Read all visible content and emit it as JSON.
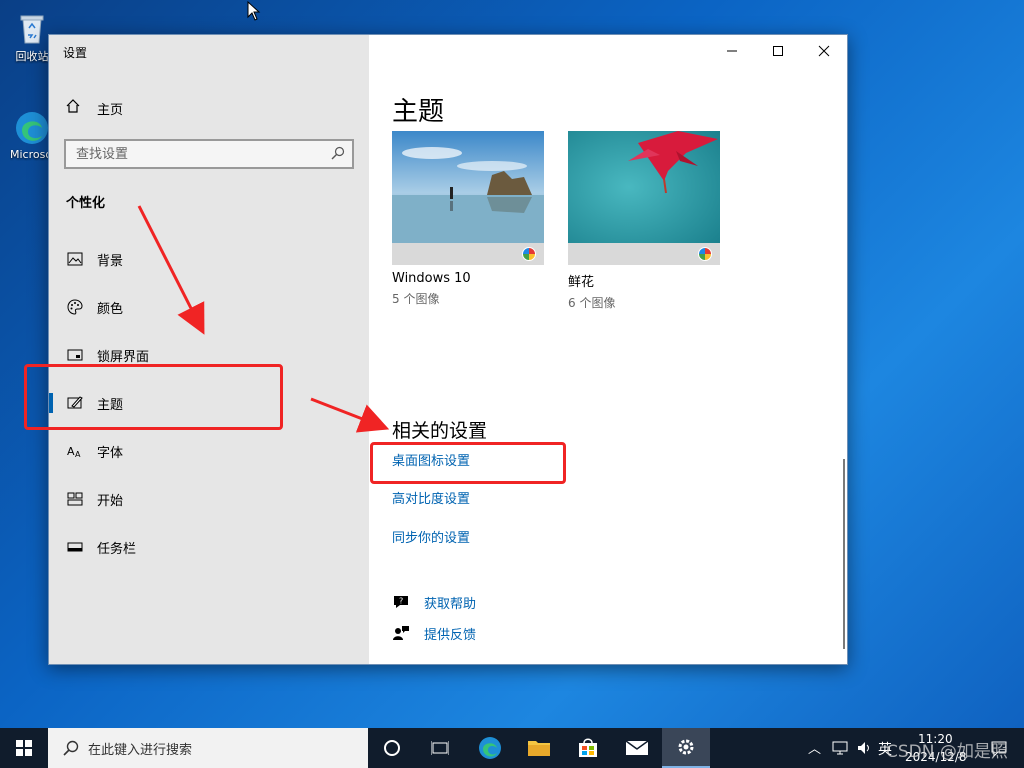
{
  "desktop": {
    "icons": [
      {
        "label": "回收站",
        "icon": "recycle-bin-icon"
      },
      {
        "label": "Microsoft Edge",
        "icon": "edge-icon"
      }
    ]
  },
  "window": {
    "title": "设置",
    "controls": [
      "minimize",
      "maximize",
      "close"
    ]
  },
  "sidebar": {
    "home_label": "主页",
    "search_placeholder": "查找设置",
    "section_title": "个性化",
    "items": [
      {
        "label": "背景",
        "icon": "picture-icon"
      },
      {
        "label": "颜色",
        "icon": "palette-icon"
      },
      {
        "label": "锁屏界面",
        "icon": "lock-screen-icon"
      },
      {
        "label": "主题",
        "icon": "theme-brush-icon",
        "active": true
      },
      {
        "label": "字体",
        "icon": "font-icon"
      },
      {
        "label": "开始",
        "icon": "start-tiles-icon"
      },
      {
        "label": "任务栏",
        "icon": "taskbar-icon"
      }
    ]
  },
  "main": {
    "title": "主题",
    "themes": [
      {
        "name": "Windows 10",
        "count": "5 个图像"
      },
      {
        "name": "鲜花",
        "count": "6 个图像"
      }
    ],
    "related_title": "相关的设置",
    "related_links": [
      "桌面图标设置",
      "高对比度设置",
      "同步你的设置"
    ],
    "help": {
      "get_help": "获取帮助",
      "feedback": "提供反馈"
    }
  },
  "taskbar": {
    "search_placeholder": "在此键入进行搜索",
    "apps": [
      "task-view-icon",
      "edge-icon",
      "file-explorer-icon",
      "store-icon",
      "mail-icon",
      "settings-gear-icon"
    ],
    "ime": "英",
    "time": "11:20",
    "date": "2024/12/8"
  },
  "watermark": "CSDN @如是照",
  "colors": {
    "accent": "#0063b1",
    "annotation": "#f02424",
    "taskbar": "#101c2c"
  }
}
